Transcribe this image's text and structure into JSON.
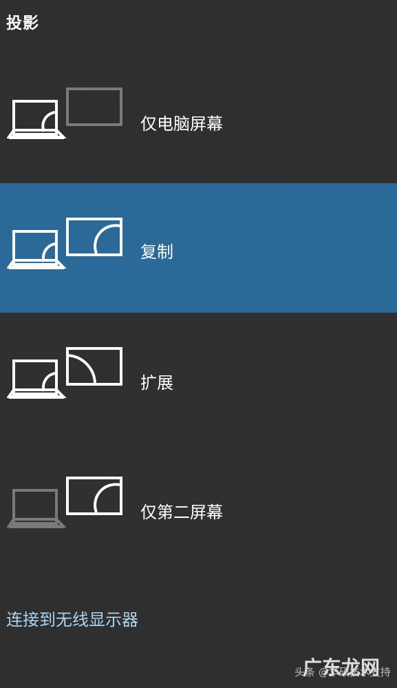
{
  "window": {
    "title": "投影"
  },
  "options": [
    {
      "label": "仅电脑屏幕",
      "icon": "pc-screen-only-icon",
      "selected": false
    },
    {
      "label": "复制",
      "icon": "duplicate-icon",
      "selected": true
    },
    {
      "label": "扩展",
      "icon": "extend-icon",
      "selected": false
    },
    {
      "label": "仅第二屏幕",
      "icon": "second-screen-only-icon",
      "selected": false
    }
  ],
  "connect_link": "连接到无线显示器",
  "watermark": {
    "text": "头条 @华硕技术支持",
    "logo": "广东龙网"
  },
  "colors": {
    "background": "#303030",
    "selected": "#2b6a98",
    "link": "#a9d4f2",
    "dimmed_icon": "#7a7a7a"
  }
}
